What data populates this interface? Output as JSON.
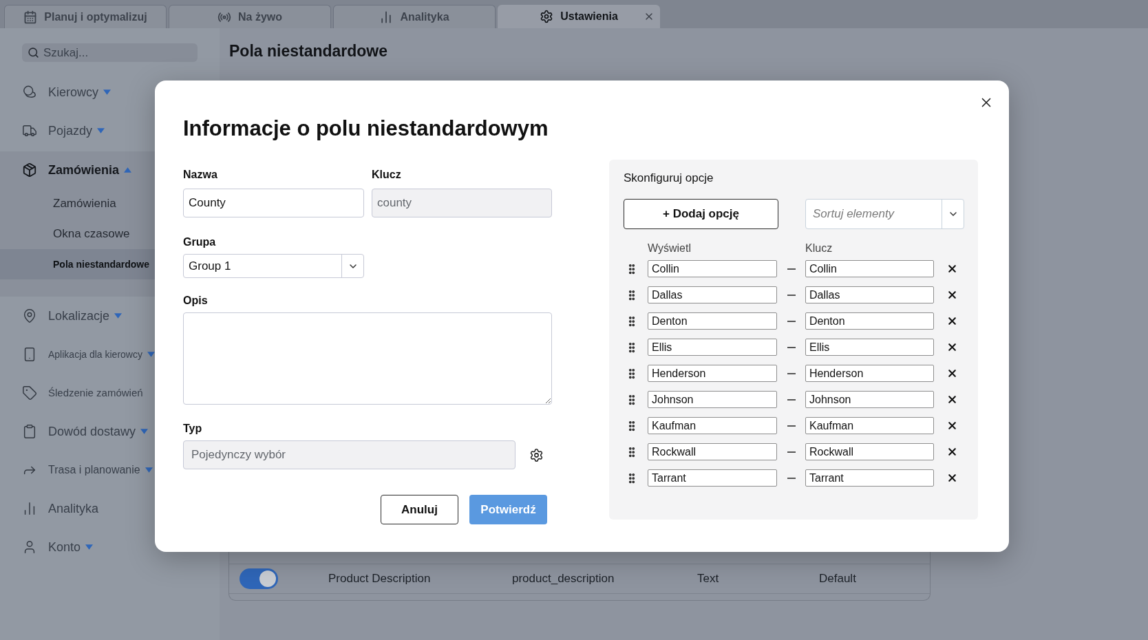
{
  "tabs": [
    {
      "label": "Planuj i optymalizuj",
      "selected": false
    },
    {
      "label": "Na żywo",
      "selected": false
    },
    {
      "label": "Analityka",
      "selected": false
    },
    {
      "label": "Ustawienia",
      "selected": true
    }
  ],
  "sidebar": {
    "search": {
      "placeholder": "Szukaj..."
    },
    "items": [
      {
        "label": "Kierowcy",
        "kind": "group",
        "expanded": false
      },
      {
        "label": "Pojazdy",
        "kind": "group",
        "expanded": false
      },
      {
        "label": "Zamówienia",
        "kind": "group",
        "expanded": true,
        "children": [
          {
            "label": "Zamówienia",
            "selected": false
          },
          {
            "label": "Okna czasowe",
            "selected": false
          },
          {
            "label": "Pola niestandardowe",
            "selected": true
          }
        ]
      },
      {
        "label": "Lokalizacje",
        "kind": "group",
        "expanded": false
      },
      {
        "label": "Aplikacja dla kierowcy",
        "kind": "group",
        "expanded": false
      },
      {
        "label": "Śledzenie zamówień",
        "kind": "link"
      },
      {
        "label": "Dowód dostawy",
        "kind": "group",
        "expanded": false
      },
      {
        "label": "Trasa i planowanie",
        "kind": "group",
        "expanded": false
      },
      {
        "label": "Analityka",
        "kind": "link"
      },
      {
        "label": "Konto",
        "kind": "group",
        "expanded": false
      }
    ]
  },
  "page": {
    "title": "Pola niestandardowe",
    "table": {
      "rows": [
        {
          "on": true,
          "cells": [
            "Product Description",
            "product_description",
            "Text",
            "Default"
          ]
        }
      ]
    }
  },
  "dialog": {
    "title": "Informacje o polu niestandardowym",
    "fields": {
      "name": {
        "label": "Nazwa",
        "value": "County",
        "disabled": false
      },
      "key": {
        "label": "Klucz",
        "value": "county",
        "disabled": true
      },
      "group": {
        "label": "Grupa",
        "value": "Group 1"
      },
      "description": {
        "label": "Opis"
      },
      "type": {
        "label": "Typ",
        "value": "Pojedynczy wybór",
        "disabled": true
      }
    },
    "buttons": [
      {
        "label": "Anuluj",
        "kind": "secondary",
        "disabled": false
      },
      {
        "label": "Potwierdź",
        "kind": "primary",
        "disabled": true
      }
    ],
    "options_panel": {
      "title": "Skonfiguruj opcje",
      "add_button": "+ Dodaj opcję",
      "sort": {
        "placeholder": "Sortuj elementy"
      },
      "columns": [
        "Wyświetl",
        "Klucz"
      ],
      "options": [
        {
          "display": "Collin",
          "key": "Collin"
        },
        {
          "display": "Dallas",
          "key": "Dallas"
        },
        {
          "display": "Denton",
          "key": "Denton"
        },
        {
          "display": "Ellis",
          "key": "Ellis"
        },
        {
          "display": "Henderson",
          "key": "Henderson"
        },
        {
          "display": "Johnson",
          "key": "Johnson"
        },
        {
          "display": "Kaufman",
          "key": "Kaufman"
        },
        {
          "display": "Rockwall",
          "key": "Rockwall"
        },
        {
          "display": "Tarrant",
          "key": "Tarrant"
        }
      ]
    }
  }
}
